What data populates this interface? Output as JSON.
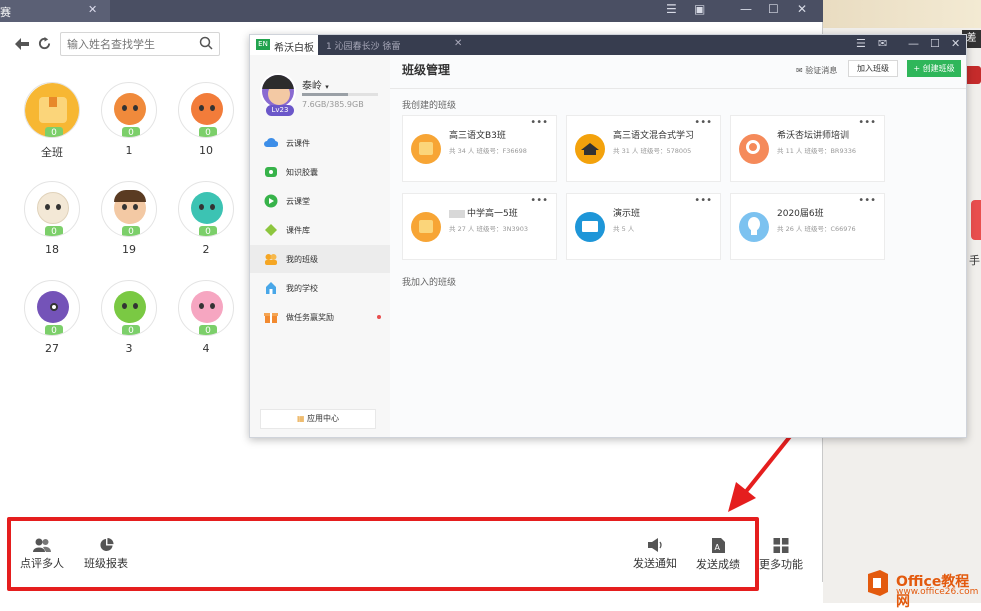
{
  "bg_window": {
    "tab_label": "赛",
    "search": {
      "placeholder": "输入姓名查找学生"
    },
    "students": [
      {
        "name": "全班",
        "score": "0",
        "color": "#f7b733"
      },
      {
        "name": "1",
        "score": "0",
        "color": "#f08a3b"
      },
      {
        "name": "10",
        "score": "0",
        "color": "#f27c3a"
      },
      {
        "name": "18",
        "score": "0",
        "color": "#f3e8d6"
      },
      {
        "name": "19",
        "score": "0",
        "color": "#7a5a3a"
      },
      {
        "name": "2",
        "score": "0",
        "color": "#3cc3b3"
      },
      {
        "name": "27",
        "score": "0",
        "color": "#7453b8"
      },
      {
        "name": "3",
        "score": "0",
        "color": "#7ac943"
      },
      {
        "name": "4",
        "score": "0",
        "color": "#f6a6c1"
      }
    ],
    "bottom": {
      "review_many": "点评多人",
      "class_report": "班级报表",
      "send_notice": "发送通知",
      "send_scores": "发送成绩",
      "more": "更多功能"
    }
  },
  "right_strip": {
    "top_char": "差",
    "mid_char": "手",
    "logo_main": "Office教程网",
    "logo_sub": "www.office26.com"
  },
  "fg_window": {
    "tab_active": "希沃白板",
    "tab_logo": "EN",
    "tab2": "1 沁园春长沙 徐雷",
    "user": {
      "name": "泰岭",
      "level": "Lv23",
      "storage": "7.6GB/385.9GB",
      "storage_used_fraction": 0.02
    },
    "sidebar": [
      {
        "label": "云课件"
      },
      {
        "label": "知识胶囊"
      },
      {
        "label": "云课堂"
      },
      {
        "label": "课件库"
      },
      {
        "label": "我的班级"
      },
      {
        "label": "我的学校"
      },
      {
        "label": "做任务赢奖励"
      }
    ],
    "app_center": "应用中心",
    "page_title": "班级管理",
    "verify_msg": "验证消息",
    "join_class": "加入班级",
    "create_class": "创建班级",
    "created_label": "我创建的班级",
    "joined_label": "我加入的班级",
    "classes": [
      {
        "name": "高三语文B3班",
        "info": "共 34 人  班级号：F36698",
        "color": "#f7a535"
      },
      {
        "name": "高三语文混合式学习",
        "info": "共 31 人  班级号：578005",
        "color": "#f3a20c"
      },
      {
        "name": "希沃杏坛讲师培训",
        "info": "共 11 人  班级号：BR9336",
        "color": "#f58a5a"
      },
      {
        "name": "中学高一5班",
        "info": "共 27 人  班级号：3N3903",
        "color": "#f7a535"
      },
      {
        "name": "演示班",
        "info": "共 5 人",
        "color": "#1e96d8"
      },
      {
        "name": "2020届6班",
        "info": "共 26 人  班级号：C66976",
        "color": "#7cc2f0"
      }
    ]
  }
}
